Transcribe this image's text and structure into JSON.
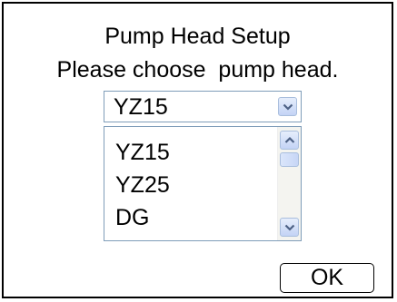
{
  "dialog": {
    "title": "Pump Head Setup",
    "prompt": "Please choose  pump head."
  },
  "select": {
    "value": "YZ15",
    "arrow_icon": "chevron-down-icon"
  },
  "listbox": {
    "items": [
      "YZ15",
      "YZ25",
      "DG"
    ],
    "scroll_up_icon": "chevron-up-icon",
    "scroll_down_icon": "chevron-down-icon"
  },
  "buttons": {
    "ok_label": "OK"
  },
  "colors": {
    "border": "#000000",
    "control_border": "#7f9db9",
    "arrow": "#4d6185",
    "arrow_button": "#c3d3f5"
  }
}
